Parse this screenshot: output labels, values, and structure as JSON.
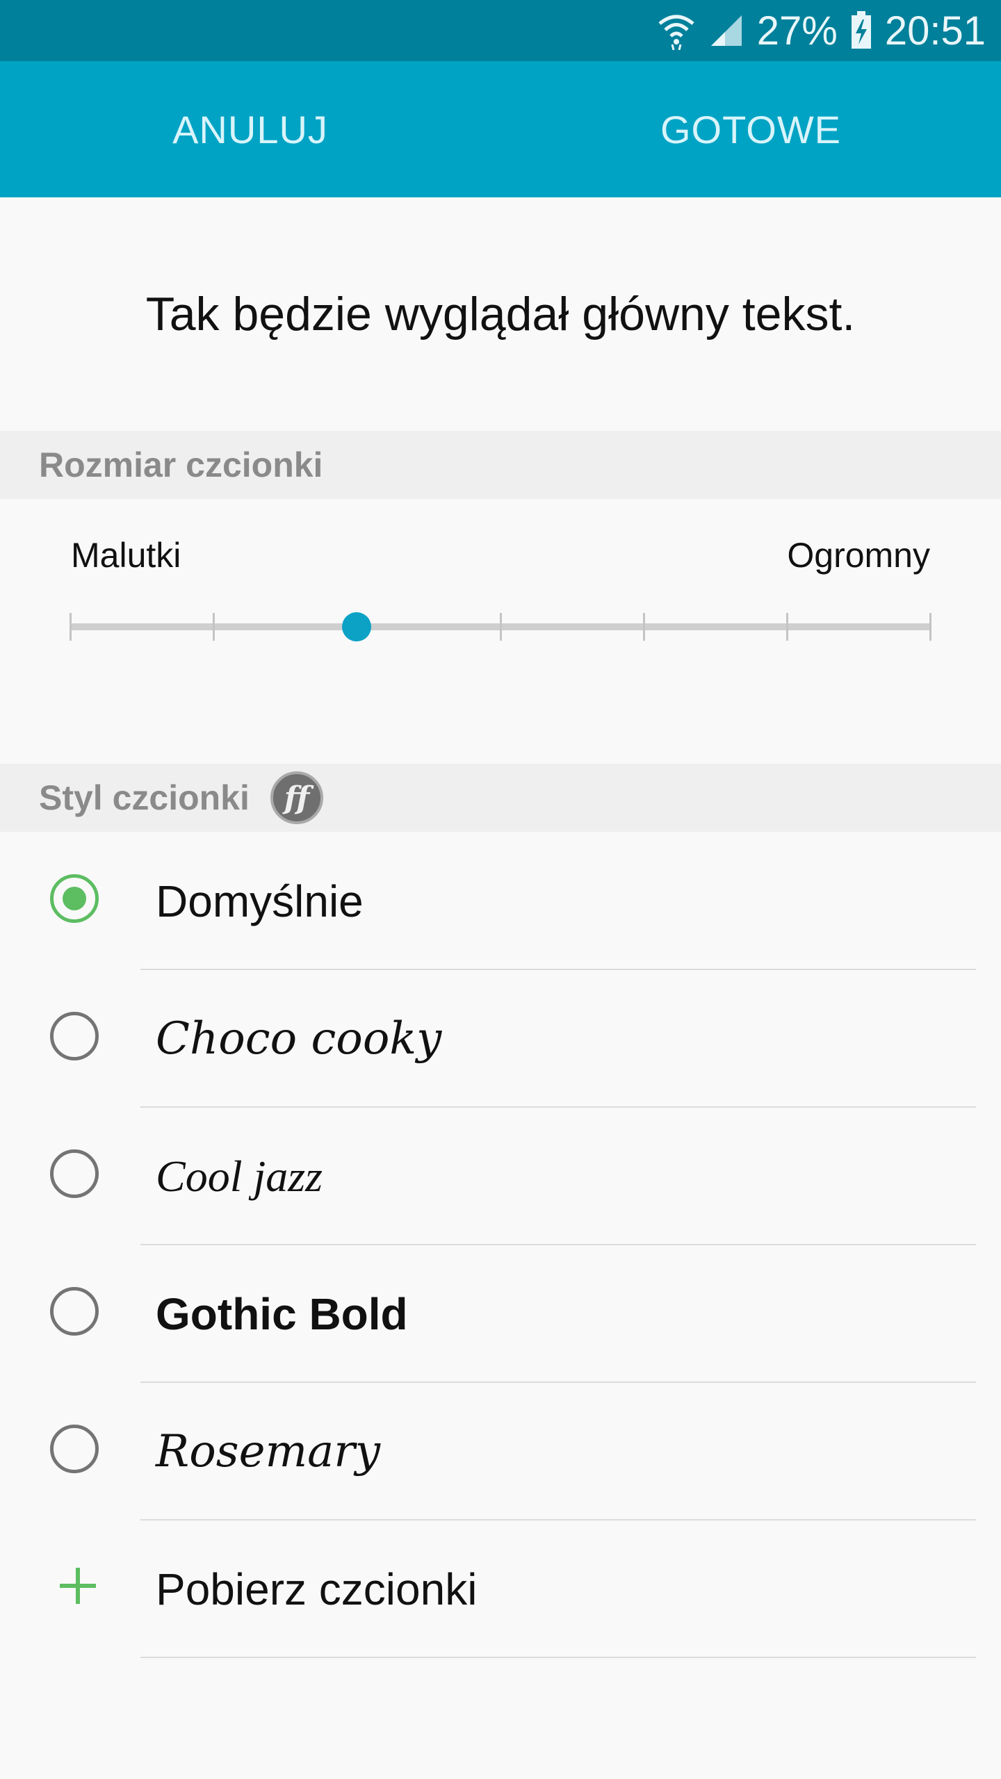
{
  "status_bar": {
    "battery_percent": "27%",
    "time": "20:51",
    "icons": [
      "wifi-icon",
      "signal-icon",
      "battery-charging-icon"
    ]
  },
  "action_bar": {
    "cancel_label": "ANULUJ",
    "done_label": "GOTOWE"
  },
  "preview_text": "Tak będzie wyglądał główny tekst.",
  "font_size": {
    "header": "Rozmiar czcionki",
    "min_label": "Malutki",
    "max_label": "Ogromny",
    "steps": 7,
    "selected_step": 3
  },
  "font_style": {
    "header": "Styl czcionki",
    "header_icon": "ff-icon",
    "header_icon_text": "ff",
    "options": [
      {
        "label": "Domyślnie",
        "selected": true
      },
      {
        "label": "Choco cooky",
        "selected": false
      },
      {
        "label": "Cool jazz",
        "selected": false
      },
      {
        "label": "Gothic Bold",
        "selected": false
      },
      {
        "label": "Rosemary",
        "selected": false
      }
    ],
    "download_label": "Pobierz czcionki",
    "download_icon": "plus-icon"
  },
  "colors": {
    "status_bar": "#00809a",
    "action_bar": "#00a3c4",
    "slider_thumb": "#0ba2c6",
    "radio_selected": "#5cbd61"
  }
}
